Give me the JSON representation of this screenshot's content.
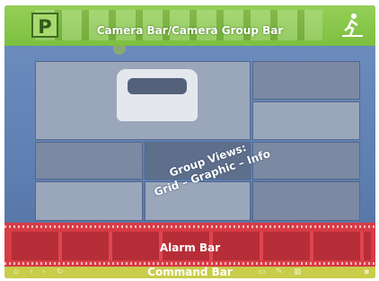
{
  "camera_bar": {
    "label": "Camera Bar/Camera Group Bar",
    "parking_sign": "P"
  },
  "group_views": {
    "line1": "Group Views:",
    "line2": "Grid – Graphic – Info"
  },
  "alarm_bar": {
    "label": "Alarm Bar"
  },
  "command_bar": {
    "label": "Command Bar"
  },
  "colors": {
    "camera_bar": "#7dbf3f",
    "alarm_bar": "#d83b45",
    "command_bar": "#c8cd4a",
    "background": "#5d7fb2"
  }
}
